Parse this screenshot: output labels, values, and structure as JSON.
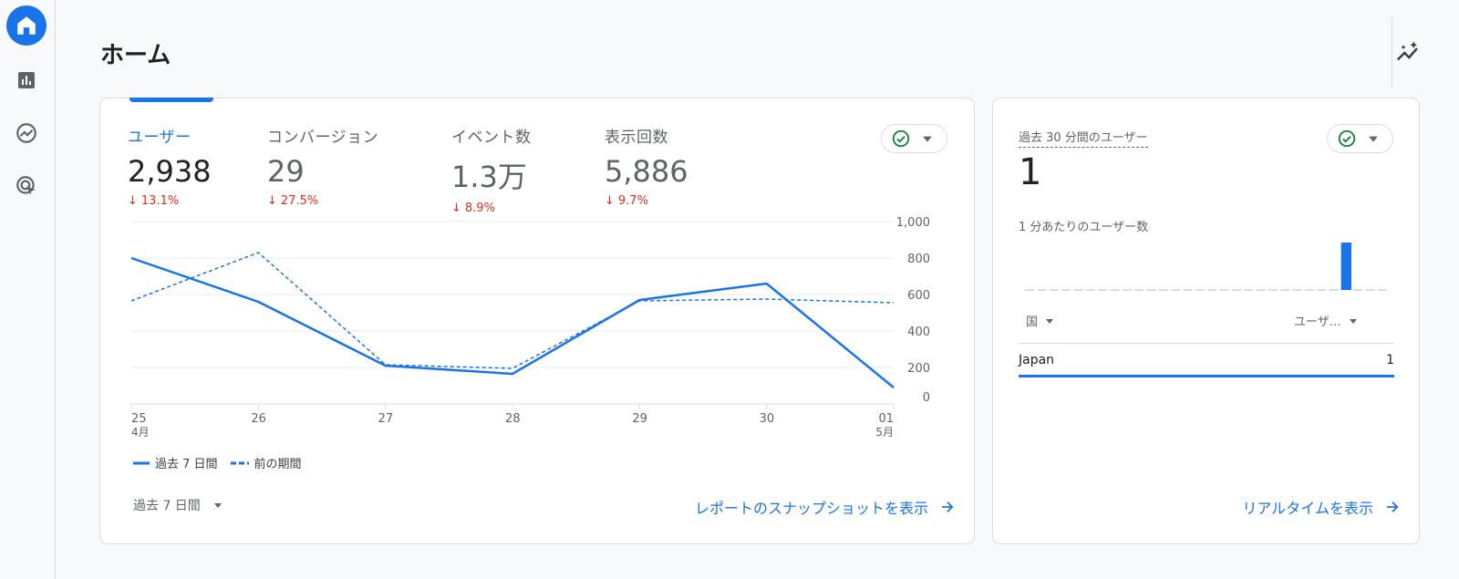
{
  "page": {
    "title": "ホーム"
  },
  "nav": {
    "items": [
      {
        "name": "home",
        "icon": "home-icon",
        "active": true
      },
      {
        "name": "reports",
        "icon": "bar-chart-icon",
        "active": false
      },
      {
        "name": "explore",
        "icon": "explore-icon",
        "active": false
      },
      {
        "name": "advertising",
        "icon": "target-cursor-icon",
        "active": false
      }
    ]
  },
  "main_card": {
    "metrics": [
      {
        "label": "ユーザー",
        "value": "2,938",
        "change": "13.1%",
        "selected": true
      },
      {
        "label": "コンバージョン",
        "value": "29",
        "change": "27.5%",
        "selected": false
      },
      {
        "label": "イベント数",
        "value": "1.3万",
        "change": "8.9%",
        "selected": false
      },
      {
        "label": "表示回数",
        "value": "5,886",
        "change": "9.7%",
        "selected": false
      }
    ],
    "legend": {
      "current": "過去 7 日間",
      "previous": "前の期間"
    },
    "period_selector": "過去 7 日間",
    "link": "レポートのスナップショットを表示"
  },
  "chart_data": {
    "type": "line",
    "x": [
      "25",
      "26",
      "27",
      "28",
      "29",
      "30",
      "01"
    ],
    "x_sublabels": [
      "4月",
      "",
      "",
      "",
      "",
      "",
      "5月"
    ],
    "y_ticks": [
      "1,000",
      "800",
      "600",
      "400",
      "200",
      "0"
    ],
    "ylim": [
      0,
      1000
    ],
    "series": [
      {
        "name": "過去 7 日間",
        "style": "solid",
        "values": [
          800,
          560,
          210,
          165,
          570,
          660,
          90
        ]
      },
      {
        "name": "前の期間",
        "style": "dashed",
        "values": [
          565,
          830,
          215,
          195,
          565,
          575,
          555
        ]
      }
    ],
    "grid": true,
    "legend_position": "bottom-left"
  },
  "realtime_card": {
    "title": "過去 30 分間のユーザー",
    "value": "1",
    "per_minute_label": "1 分あたりのユーザー数",
    "minute_bars": [
      0,
      0,
      0,
      0,
      0,
      0,
      0,
      0,
      0,
      0,
      0,
      0,
      0,
      0,
      0,
      0,
      0,
      0,
      0,
      0,
      0,
      0,
      0,
      0,
      0,
      0,
      1,
      0,
      0,
      0
    ],
    "table": {
      "col_country": "国",
      "col_users": "ユーザ…",
      "rows": [
        {
          "country": "Japan",
          "users": "1"
        }
      ]
    },
    "link": "リアルタイムを表示"
  },
  "colors": {
    "accent": "#1a73e8",
    "decline": "#d93025",
    "status_ok": "#188038"
  }
}
